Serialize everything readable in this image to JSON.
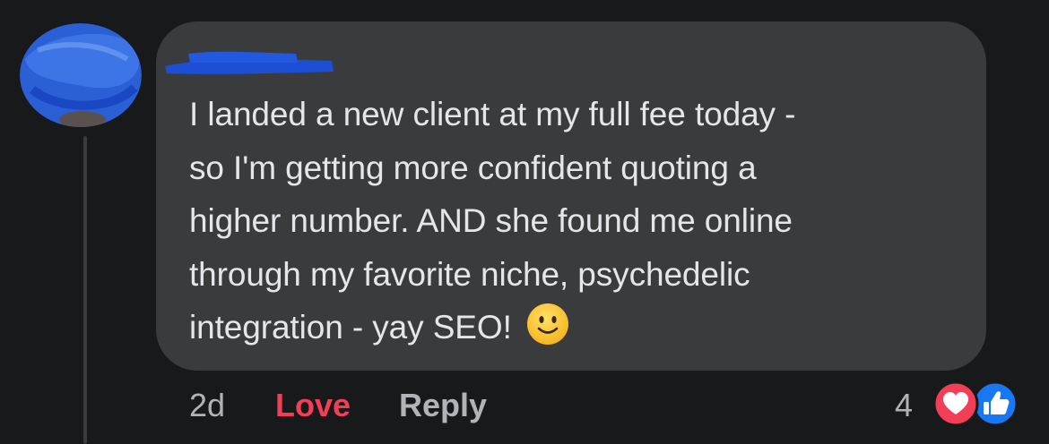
{
  "comment": {
    "text_lines": [
      "I landed a new client at my full fee today -",
      "so I'm getting more confident quoting a",
      "higher number. AND she found me online",
      "through my favorite niche, psychedelic",
      "integration - yay SEO!"
    ],
    "emoji": "slightly-smiling-face-icon"
  },
  "actions": {
    "timestamp": "2d",
    "love_label": "Love",
    "reply_label": "Reply"
  },
  "reactions": {
    "count": "4",
    "types": [
      "heart-icon",
      "like-thumb-icon"
    ]
  },
  "colors": {
    "background": "#18191a",
    "bubble": "#3a3b3c",
    "text": "#e4e6eb",
    "muted": "#b0b3b8",
    "love": "#f33e58",
    "like": "#1877f2",
    "redaction_blue": "#1c4fd4"
  }
}
